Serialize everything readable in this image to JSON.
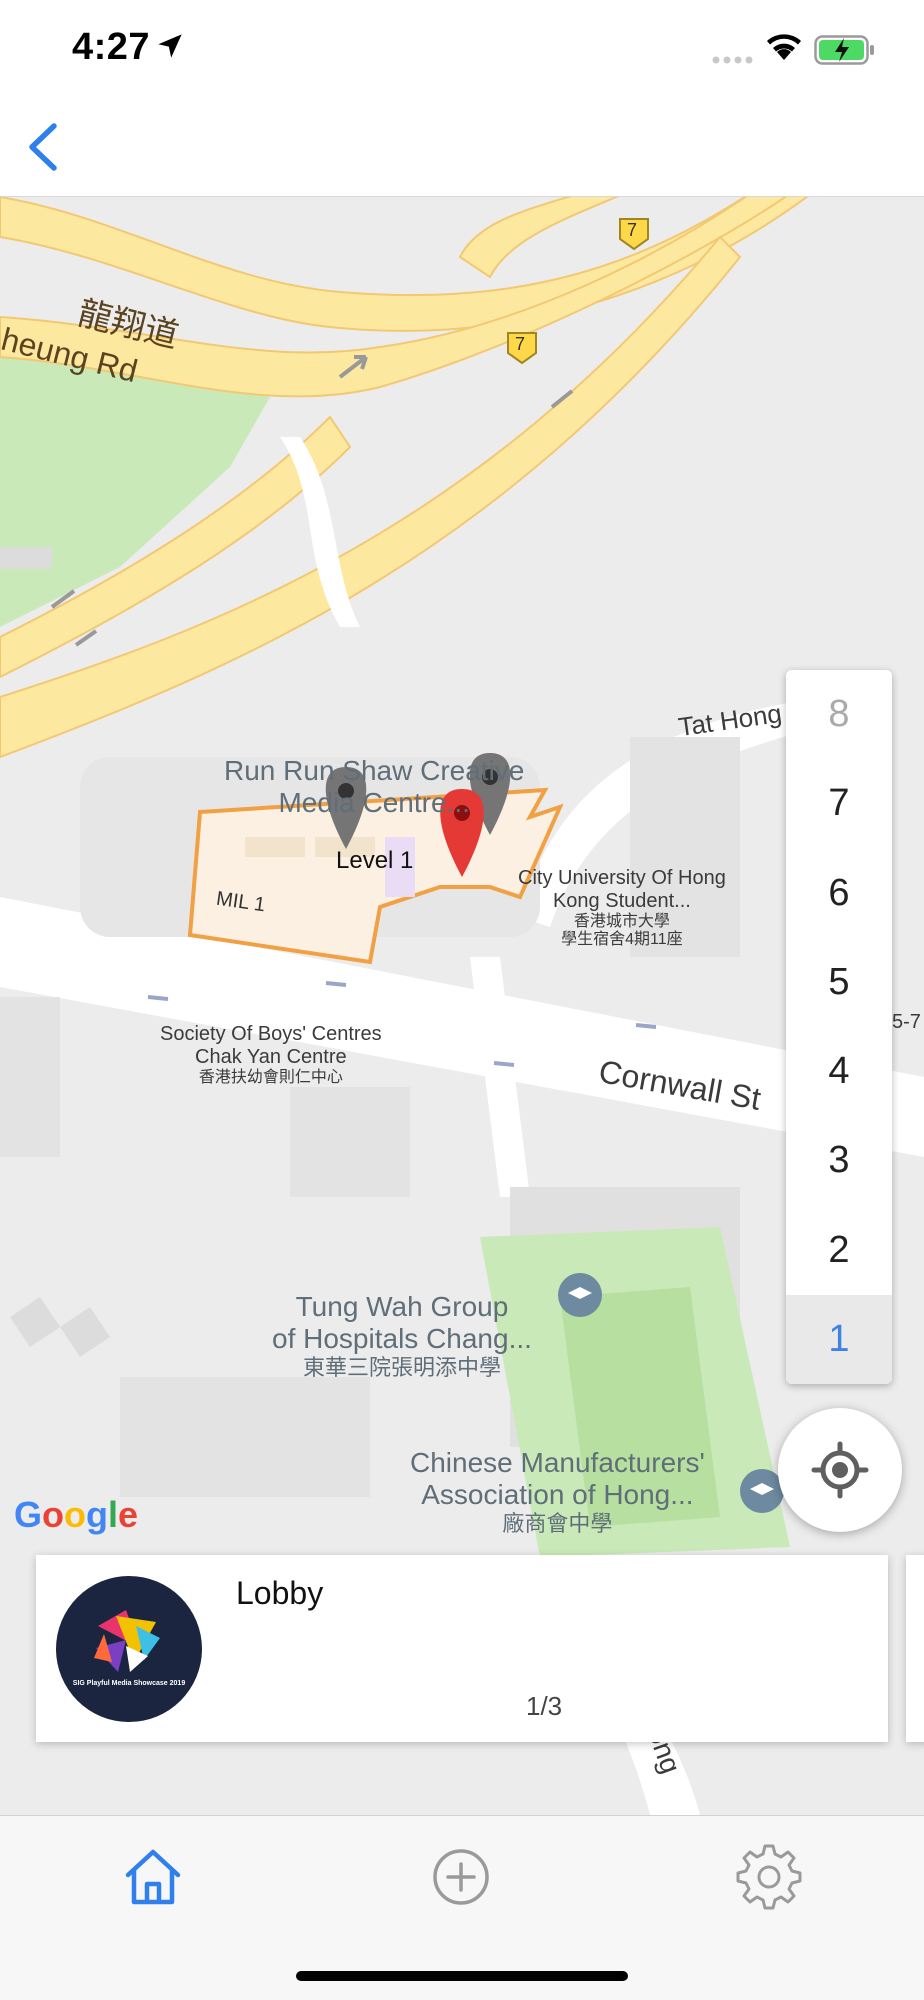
{
  "status_bar": {
    "time": "4:27",
    "icons": [
      "location-arrow-icon",
      "signal-icon",
      "wifi-icon",
      "battery-charging-icon"
    ]
  },
  "nav": {
    "back_icon": "chevron-left-icon",
    "accent": "#2f80ed"
  },
  "map": {
    "road_labels": {
      "chinese_road": "龍翔道",
      "english_road": "heung Rd",
      "tat_hong": "Tat Hong",
      "cornwall": "Cornwall St",
      "partial_right": "5-7",
      "road_bottom": "eong",
      "route_shield_1": "7",
      "route_shield_2": "7"
    },
    "building": {
      "name_line1": "Run Run Shaw Creative",
      "name_line2": "Media Centre...",
      "level_label": "Level 1",
      "mil_label": "MIL 1"
    },
    "pois": [
      {
        "line1": "City University Of Hong",
        "line2": "Kong Student...",
        "line3": "香港城市大學",
        "line4": "學生宿舍4期11座"
      },
      {
        "line1": "Society Of Boys' Centres",
        "line2": "Chak Yan Centre",
        "line3": "香港扶幼會則仁中心"
      },
      {
        "line1": "Tung Wah Group",
        "line2": "of Hospitals Chang...",
        "line3": "東華三院張明添中學"
      },
      {
        "line1": "Chinese Manufacturers'",
        "line2": "Association of Hong...",
        "line3": "廠商會中學"
      }
    ],
    "google_logo": "Google"
  },
  "floor_picker": {
    "floors": [
      "8",
      "7",
      "6",
      "5",
      "4",
      "3",
      "2",
      "1"
    ],
    "selected": "1",
    "accent": "#3d82e4"
  },
  "locate_icon": "crosshair-icon",
  "card": {
    "title": "Lobby",
    "pager": "1/3",
    "avatar_caption": "SIG Playful Media Showcase 2019"
  },
  "tab_bar": {
    "tabs": [
      {
        "icon": "home-icon",
        "active": true
      },
      {
        "icon": "add-circle-icon",
        "active": false
      },
      {
        "icon": "gear-icon",
        "active": false
      }
    ],
    "active_color": "#2f80ed",
    "inactive_color": "#9a9a9a"
  }
}
